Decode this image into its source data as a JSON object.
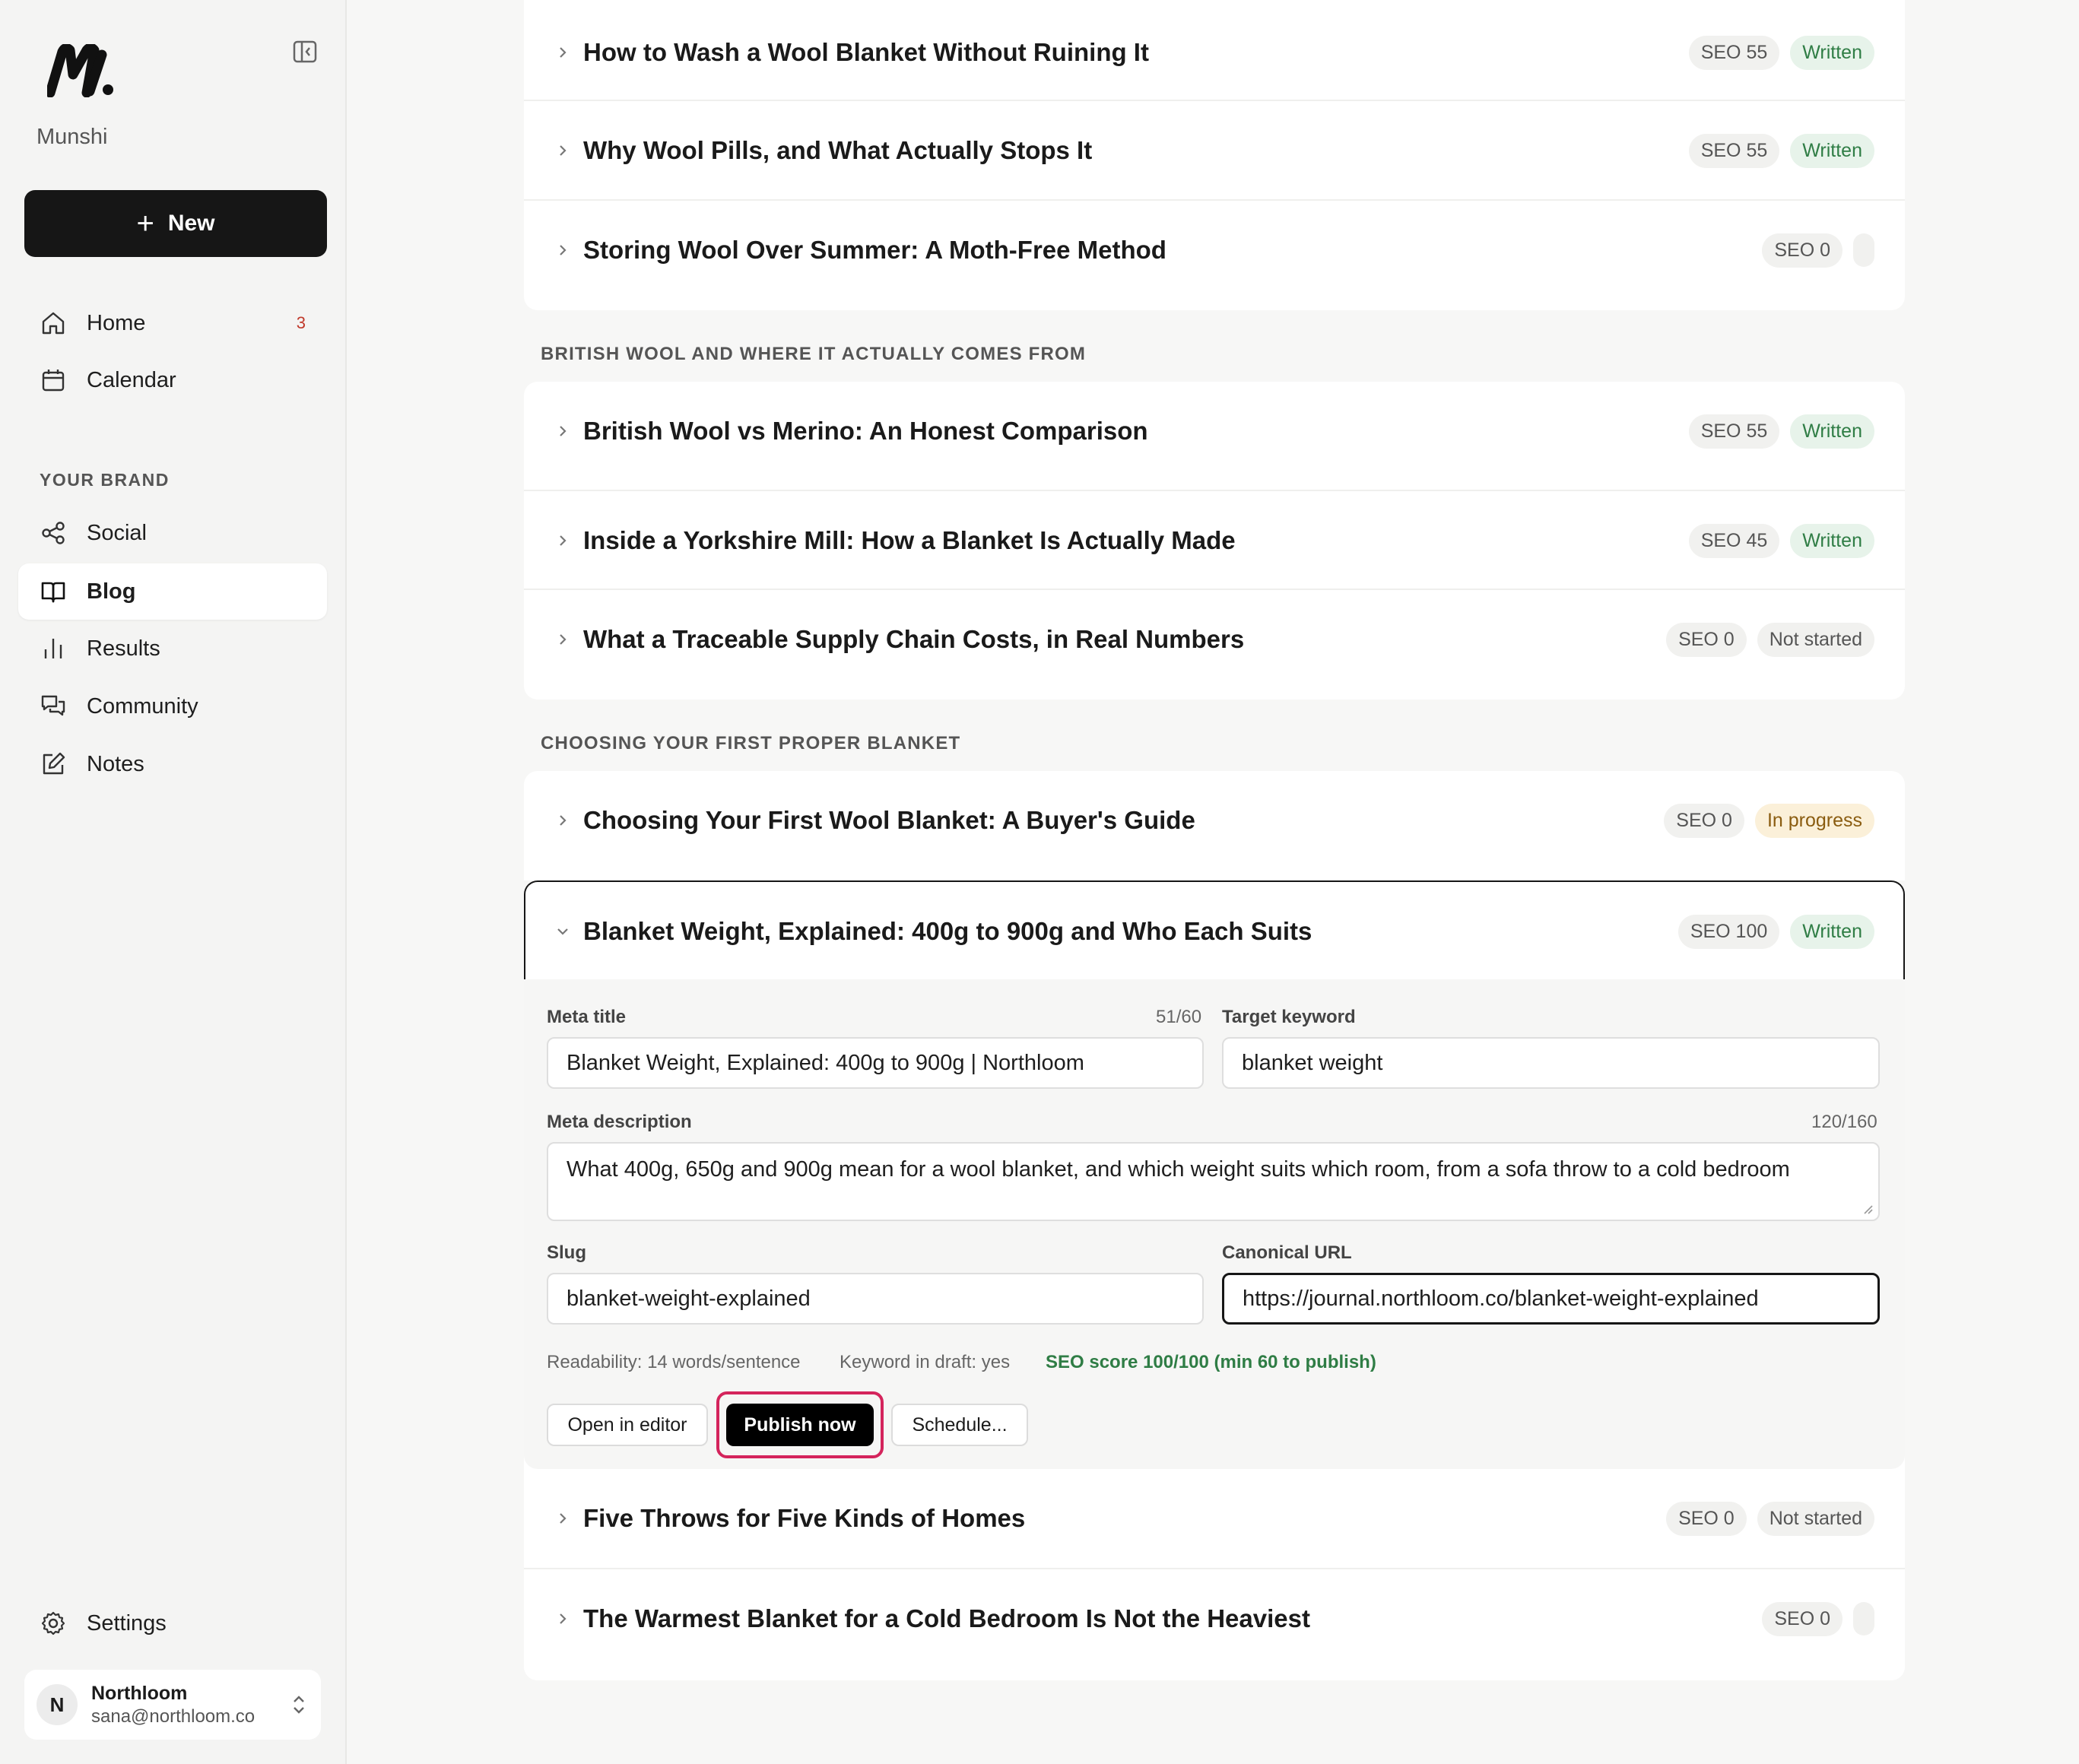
{
  "app": {
    "brand": "Munshi"
  },
  "sidebar": {
    "new_label": "New",
    "nav": [
      {
        "label": "Home",
        "icon": "home-icon",
        "badge": "3"
      },
      {
        "label": "Calendar",
        "icon": "calendar-icon"
      }
    ],
    "section_label": "YOUR BRAND",
    "brand_nav": [
      {
        "label": "Social",
        "icon": "share-icon"
      },
      {
        "label": "Blog",
        "icon": "book-icon",
        "active": true
      },
      {
        "label": "Results",
        "icon": "bar-chart-icon"
      },
      {
        "label": "Community",
        "icon": "chat-icon"
      },
      {
        "label": "Notes",
        "icon": "edit-icon"
      }
    ],
    "settings_label": "Settings",
    "account": {
      "initial": "N",
      "name": "Northloom",
      "email": "sana@northloom.co"
    }
  },
  "groups": [
    {
      "label": "",
      "posts": [
        {
          "title": "How to Wash a Wool Blanket Without Ruining It",
          "seo": "SEO 55",
          "status": "Written"
        },
        {
          "title": "Why Wool Pills, and What Actually Stops It",
          "seo": "SEO 55",
          "status": "Written"
        },
        {
          "title": "Storing Wool Over Summer: A Moth-Free Method",
          "seo": "SEO 0",
          "status": ""
        }
      ]
    },
    {
      "label": "BRITISH WOOL AND WHERE IT ACTUALLY COMES FROM",
      "posts": [
        {
          "title": "British Wool vs Merino: An Honest Comparison",
          "seo": "SEO 55",
          "status": "Written"
        },
        {
          "title": "Inside a Yorkshire Mill: How a Blanket Is Actually Made",
          "seo": "SEO 45",
          "status": "Written"
        },
        {
          "title": "What a Traceable Supply Chain Costs, in Real Numbers",
          "seo": "SEO 0",
          "status": "Not started"
        }
      ]
    },
    {
      "label": "CHOOSING YOUR FIRST PROPER BLANKET",
      "posts": [
        {
          "title": "Choosing Your First Wool Blanket: A Buyer's Guide",
          "seo": "SEO 0",
          "status": "In progress"
        },
        {
          "title": "Blanket Weight, Explained: 400g to 900g and Who Each Suits",
          "seo": "SEO 100",
          "status": "Written"
        },
        {
          "title": "Five Throws for Five Kinds of Homes",
          "seo": "SEO 0",
          "status": "Not started"
        },
        {
          "title": "The Warmest Blanket for a Cold Bedroom Is Not the Heaviest",
          "seo": "SEO 0",
          "status": ""
        }
      ]
    }
  ],
  "editor": {
    "meta_title_label": "Meta title",
    "meta_title_count": "51/60",
    "meta_title_value": "Blanket Weight, Explained: 400g to 900g | Northloom",
    "target_keyword_label": "Target keyword",
    "target_keyword_value": "blanket weight",
    "meta_description_label": "Meta description",
    "meta_description_count": "120/160",
    "meta_description_value": "What 400g, 650g and 900g mean for a wool blanket, and which weight suits which room, from a sofa throw to a cold bedroom",
    "slug_label": "Slug",
    "slug_value": "blanket-weight-explained",
    "canonical_label": "Canonical URL",
    "canonical_value": "https://journal.northloom.co/blanket-weight-explained",
    "readability": "Readability: 14 words/sentence",
    "keyword_in_draft": "Keyword in draft: yes",
    "seo_score": "SEO score 100/100 (min 60 to publish)",
    "open_editor_label": "Open in editor",
    "publish_label": "Publish now",
    "schedule_label": "Schedule..."
  }
}
